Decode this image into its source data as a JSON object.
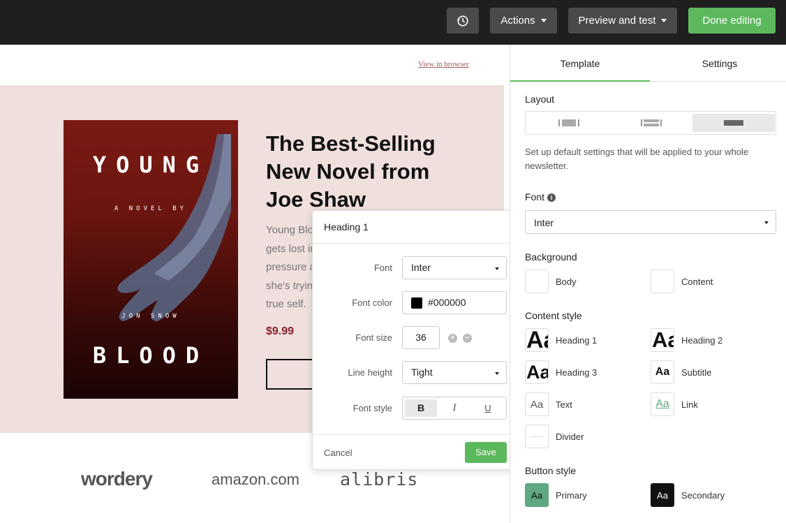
{
  "topbar": {
    "history_icon": "history-icon",
    "actions_label": "Actions",
    "preview_label": "Preview and test",
    "done_label": "Done editing"
  },
  "canvas": {
    "view_in_browser": "View in browser",
    "book": {
      "cover_title": "YOUNG",
      "cover_subtitle": "A NOVEL BY",
      "cover_author": "JON SNOW",
      "cover_bottom": "BLOOD"
    },
    "title": "The Best-Selling New Novel from Joe Shaw",
    "body_lines": [
      "Young Blo",
      "gets lost in",
      "pressure a",
      "she's tryin",
      "true self."
    ],
    "price": "$9.99",
    "logos": [
      "wordery",
      "amazon.com",
      "alibris"
    ]
  },
  "popup": {
    "title": "Heading 1",
    "font_label": "Font",
    "font_value": "Inter",
    "color_label": "Font color",
    "color_value": "#000000",
    "size_label": "Font size",
    "size_value": "36",
    "line_label": "Line height",
    "line_value": "Tight",
    "style_label": "Font style",
    "bold": "B",
    "italic": "I",
    "underline": "U",
    "cancel": "Cancel",
    "save": "Save"
  },
  "panel": {
    "tabs": [
      "Template",
      "Settings"
    ],
    "layout_label": "Layout",
    "description": "Set up default settings that will be applied to your whole newsletter.",
    "font_label": "Font",
    "font_value": "Inter",
    "background_label": "Background",
    "background_items": [
      "Body",
      "Content"
    ],
    "content_style_label": "Content style",
    "content_items": [
      "Heading 1",
      "Heading 2",
      "Heading 3",
      "Subtitle",
      "Text",
      "Link",
      "Divider"
    ],
    "button_style_label": "Button style",
    "button_items": [
      "Primary",
      "Secondary"
    ],
    "swatch_text": "Aa"
  },
  "colors": {
    "accent": "#5cb85c",
    "price": "#8a1e2a",
    "hero_bg": "#efdfdd",
    "primary_btn": "#5fa883"
  }
}
